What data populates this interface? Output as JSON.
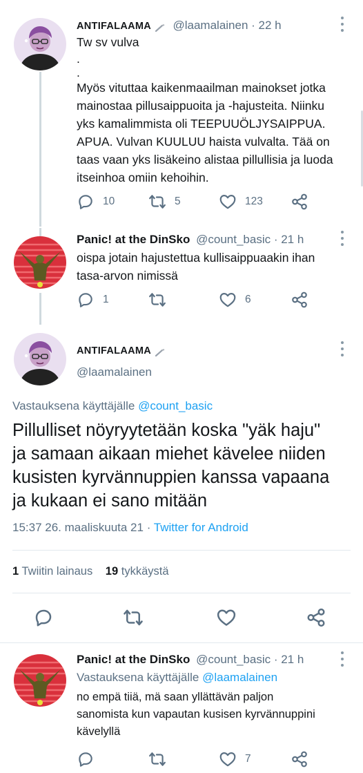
{
  "tweets": [
    {
      "name": "ANTIFALAAMA",
      "handle": "@laamalainen",
      "time": "· 22 h",
      "text_lines": [
        "Tw sv vulva",
        ".",
        ".",
        "Myös vituttaa kaikenmaailman mainokset jotka",
        "mainostaa pillusaippuoita ja -hajusteita. Niinku",
        "yks kamalimmista oli TEEPUUÖLJYSAIPPUA.",
        "APUA. Vulvan KUULUU haista vulvalta. Tää on",
        "taas vaan yks lisäkeino alistaa pillullisia ja luoda",
        "itseinhoa omiin kehoihin."
      ],
      "replies": "10",
      "retweets": "5",
      "likes": "123"
    },
    {
      "name": "Panic! at the DinSko",
      "handle": "@count_basic",
      "time": "· 21 h",
      "text_lines": [
        "oispa jotain hajustettua kullisaippuaakin ihan",
        "tasa-arvon nimissä"
      ],
      "replies": "1",
      "retweets": "",
      "likes": "6"
    }
  ],
  "main_tweet": {
    "name": "ANTIFALAAMA",
    "handle": "@laamalainen",
    "reply_prefix": "Vastauksena käyttäjälle",
    "reply_mention": "@count_basic",
    "text_lines": [
      "Pillulliset nöyryytetään koska \"yäk haju\"",
      "ja samaan aikaan miehet kävelee niiden",
      "kusisten kyrvännuppien kanssa vapaana",
      "ja kukaan ei sano mitään"
    ],
    "timestamp": "15:37 26. maaliskuuta 21",
    "source": "Twitter for Android",
    "quotes_count": "1",
    "quotes_label": "Twiitin lainaus",
    "likes_count": "19",
    "likes_label": "tykkäystä"
  },
  "last_tweet": {
    "name": "Panic! at the DinSko",
    "handle": "@count_basic",
    "time": "· 21 h",
    "reply_prefix": "Vastauksena käyttäjälle",
    "reply_mention": "@laamalainen",
    "text_lines": [
      "no empä tiiä, mä saan yllättävän paljon",
      "sanomista kun vapautan kusisen kyrvännuppini",
      "kävelyllä"
    ],
    "replies": "",
    "retweets": "",
    "likes": "7"
  },
  "icons": {
    "reply": "reply-icon",
    "retweet": "retweet-icon",
    "like": "heart-icon",
    "share": "share-icon",
    "menu": "more-vertical-icon",
    "name_emoji": "brush-icon"
  },
  "colors": {
    "link": "#1da1f2",
    "secondary_text": "#5b7083",
    "thread_line": "#cfd9de"
  }
}
